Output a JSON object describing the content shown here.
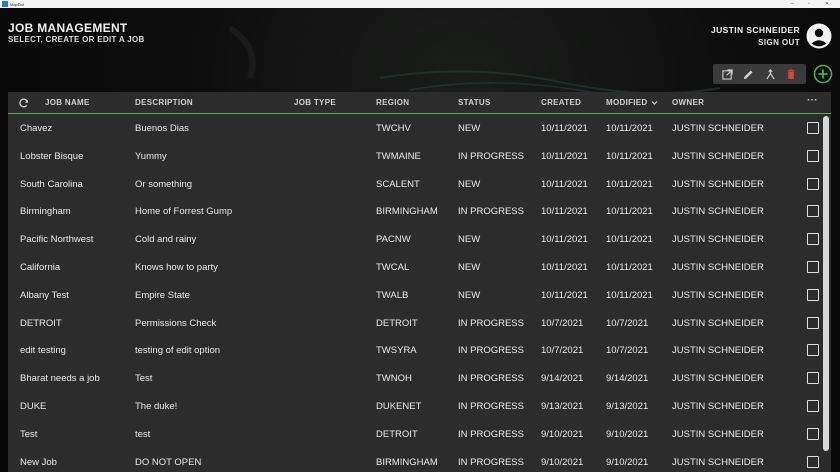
{
  "window": {
    "title": "MapDot",
    "minimize": "–",
    "maximize": "▫",
    "close": "✕"
  },
  "header": {
    "title": "JOB MANAGEMENT",
    "subtitle": "SELECT, CREATE OR EDIT A JOB"
  },
  "user": {
    "name": "JUSTIN SCHNEIDER",
    "sign_out": "SIGN OUT"
  },
  "toolbar": {
    "icons": [
      "open-external-icon",
      "edit-icon",
      "merge-icon",
      "delete-icon"
    ],
    "add_icon": "add-circle-icon",
    "accent": "#4caf50",
    "delete_color": "#d9453d"
  },
  "columns": {
    "refresh_icon": "refresh-icon",
    "job_name": "JOB NAME",
    "description": "DESCRIPTION",
    "job_type": "JOB TYPE",
    "region": "REGION",
    "status": "STATUS",
    "created": "CREATED",
    "modified": "MODIFIED",
    "owner": "OWNER",
    "more": "···"
  },
  "rows": [
    {
      "name": "Chavez",
      "description": "Buenos Dias",
      "job_type": "",
      "region": "TWCHV",
      "status": "NEW",
      "created": "10/11/2021",
      "modified": "10/11/2021",
      "owner": "JUSTIN SCHNEIDER"
    },
    {
      "name": "Lobster Bisque",
      "description": "Yummy",
      "job_type": "",
      "region": "TWMAINE",
      "status": "IN PROGRESS",
      "created": "10/11/2021",
      "modified": "10/11/2021",
      "owner": "JUSTIN SCHNEIDER"
    },
    {
      "name": "South Carolina",
      "description": "Or something",
      "job_type": "",
      "region": "SCALENT",
      "status": "NEW",
      "created": "10/11/2021",
      "modified": "10/11/2021",
      "owner": "JUSTIN SCHNEIDER"
    },
    {
      "name": "Birmingham",
      "description": "Home of Forrest Gump",
      "job_type": "",
      "region": "BIRMINGHAM",
      "status": "IN PROGRESS",
      "created": "10/11/2021",
      "modified": "10/11/2021",
      "owner": "JUSTIN SCHNEIDER"
    },
    {
      "name": "Pacific Northwest",
      "description": "Cold and rainy",
      "job_type": "",
      "region": "PACNW",
      "status": "NEW",
      "created": "10/11/2021",
      "modified": "10/11/2021",
      "owner": "JUSTIN SCHNEIDER"
    },
    {
      "name": "California",
      "description": "Knows how to party",
      "job_type": "",
      "region": "TWCAL",
      "status": "NEW",
      "created": "10/11/2021",
      "modified": "10/11/2021",
      "owner": "JUSTIN SCHNEIDER"
    },
    {
      "name": "Albany Test",
      "description": "Empire State",
      "job_type": "",
      "region": "TWALB",
      "status": "NEW",
      "created": "10/11/2021",
      "modified": "10/11/2021",
      "owner": "JUSTIN SCHNEIDER"
    },
    {
      "name": "DETROIT",
      "description": "Permissions Check",
      "job_type": "",
      "region": "DETROIT",
      "status": "IN PROGRESS",
      "created": "10/7/2021",
      "modified": "10/7/2021",
      "owner": "JUSTIN SCHNEIDER"
    },
    {
      "name": "edit testing",
      "description": "testing of edit option",
      "job_type": "",
      "region": "TWSYRA",
      "status": "IN PROGRESS",
      "created": "10/7/2021",
      "modified": "10/7/2021",
      "owner": "JUSTIN SCHNEIDER"
    },
    {
      "name": "Bharat needs a job",
      "description": "Test",
      "job_type": "",
      "region": "TWNOH",
      "status": "IN PROGRESS",
      "created": "9/14/2021",
      "modified": "9/14/2021",
      "owner": "JUSTIN SCHNEIDER"
    },
    {
      "name": "DUKE",
      "description": "The duke!",
      "job_type": "",
      "region": "DUKENET",
      "status": "IN PROGRESS",
      "created": "9/13/2021",
      "modified": "9/13/2021",
      "owner": "JUSTIN SCHNEIDER"
    },
    {
      "name": "Test",
      "description": "test",
      "job_type": "",
      "region": "DETROIT",
      "status": "IN PROGRESS",
      "created": "9/10/2021",
      "modified": "9/10/2021",
      "owner": "JUSTIN SCHNEIDER"
    },
    {
      "name": "New Job",
      "description": "DO NOT OPEN",
      "job_type": "",
      "region": "BIRMINGHAM",
      "status": "IN PROGRESS",
      "created": "9/10/2021",
      "modified": "9/10/2021",
      "owner": "JUSTIN SCHNEIDER"
    }
  ]
}
